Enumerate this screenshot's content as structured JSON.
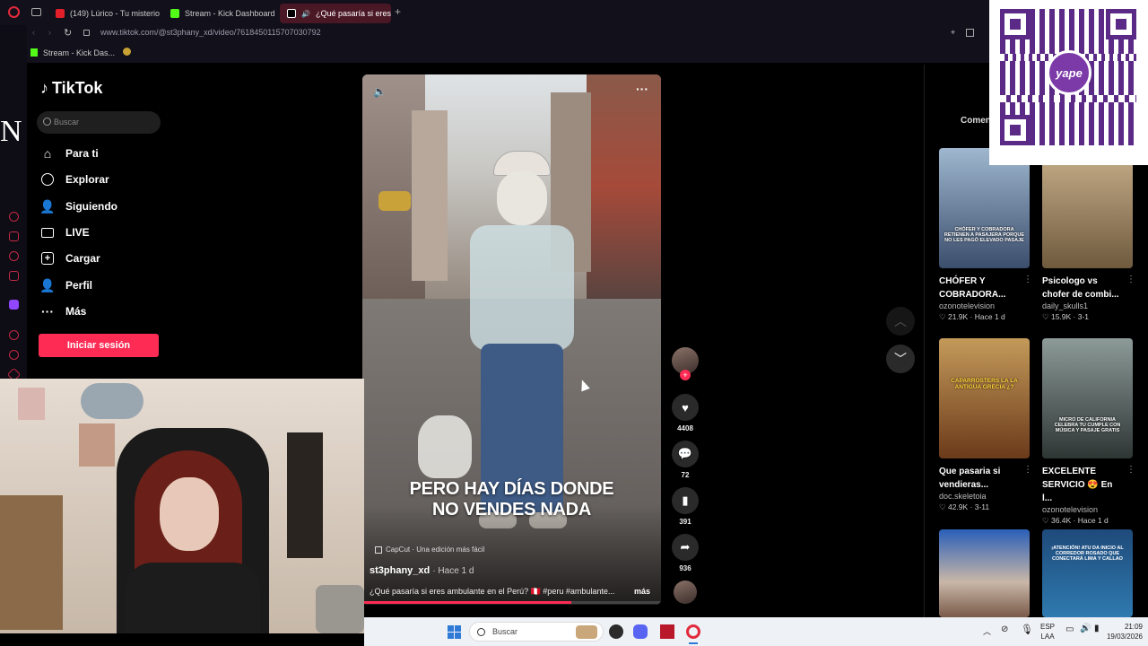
{
  "browser": {
    "tabs": [
      {
        "label": "(149) Lúrico - Tu misterios",
        "favicon_color": "#e3202a"
      },
      {
        "label": "Stream - Kick Dashboard",
        "favicon_color": "#53fc18"
      },
      {
        "label": "¿Qué pasaría si eres ar",
        "favicon_color": "#ffffff"
      }
    ],
    "new_tab": "+",
    "url": "www.tiktok.com/@st3phany_xd/video/7618450115707030792",
    "bookmark": "Stream - Kick Das..."
  },
  "sidebar_letter": "N",
  "tiktok": {
    "logo": "TikTok",
    "search_placeholder": "Buscar",
    "nav": [
      {
        "label": "Para ti",
        "icon": "home-icon"
      },
      {
        "label": "Explorar",
        "icon": "compass-icon"
      },
      {
        "label": "Siguiendo",
        "icon": "following-icon"
      },
      {
        "label": "LIVE",
        "icon": "live-icon"
      },
      {
        "label": "Cargar",
        "icon": "upload-icon"
      },
      {
        "label": "Perfil",
        "icon": "profile-icon"
      },
      {
        "label": "Más",
        "icon": "more-icon"
      }
    ],
    "login_button": "Iniciar sesión",
    "accent": "#fe2c55"
  },
  "video": {
    "caption_line1": "PERO HAY DÍAS DONDE",
    "caption_line2": "NO VENDES NADA",
    "capcut": "CapCut · Una edición más fácil",
    "author": "st3phany_xd",
    "time": "· Hace 1 d",
    "description": "¿Qué pasaría si eres ambulante en el Perú? 🇵🇪 #peru #ambulante...",
    "more": "más"
  },
  "actions": {
    "likes": "4408",
    "comments": "72",
    "saves": "391",
    "shares": "936"
  },
  "right_panel": {
    "tab": "Comen",
    "cards": [
      {
        "thumb_text": "CHÓFER Y COBRADORA RETIENEN A PASAJERA PORQUE NO LES PAGÓ ELEVADO PASAJE",
        "title": "CHÓFER Y COBRADORA...",
        "author": "ozonotelevision",
        "meta": "♡ 21.9K · Hace 1 d"
      },
      {
        "thumb_text": "",
        "title": "Psicologo vs chofer de combi...",
        "author": "daily_skulls1",
        "meta": "♡ 15.9K · 3-1"
      },
      {
        "thumb_text": "CAPARROSTERS LA LA ANTIGUA GRECIA ¿?",
        "title": "Que pasaria si vendieras...",
        "author": "doc.skeletoia",
        "meta": "♡ 42.9K · 3-11"
      },
      {
        "thumb_text": "MICRO DE CALIFORNIA CELEBRA TU CUMPLE CON MÚSICA Y PASAJE GRATIS",
        "title": "EXCELENTE SERVICIO 😍 En l...",
        "author": "ozonotelevision",
        "meta": "♡ 36.4K · Hace 1 d"
      },
      {
        "thumb_text": "",
        "title": "",
        "author": "",
        "meta": ""
      },
      {
        "thumb_text": "¡ATENCIÓN! ATU DA INICIO AL CORREDOR ROSADO QUE CONECTARÁ LIMA Y CALLAO",
        "title": "",
        "author": "",
        "meta": ""
      }
    ]
  },
  "qr_brand": "yape",
  "taskbar": {
    "search": "Buscar",
    "lang1": "ESP",
    "lang2": "LAA",
    "time": "21:09",
    "date": "19/03/2026"
  }
}
